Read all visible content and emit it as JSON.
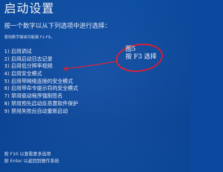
{
  "screen": {
    "title": "启动设置",
    "instruction": "按一个数字以从下列选项中进行选择：",
    "note": "使用数字键或功能键 F1-F9。"
  },
  "options": [
    {
      "num": "1)",
      "label": "启用调试"
    },
    {
      "num": "2)",
      "label": "启用启动日志记录"
    },
    {
      "num": "3)",
      "label": "启用低分辨率视频"
    },
    {
      "num": "4)",
      "label": "启用安全模式"
    },
    {
      "num": "5)",
      "label": "启用带网络连接的安全模式"
    },
    {
      "num": "6)",
      "label": "启用带命令提示符的安全模式"
    },
    {
      "num": "7)",
      "label": "禁用驱动程序强制签名"
    },
    {
      "num": "8)",
      "label": "禁用预先启动反恶意软件保护"
    },
    {
      "num": "9)",
      "label": "禁用失败后自动重新启动"
    }
  ],
  "annotation": {
    "line1": "图5",
    "line2": "按 F3 选择",
    "color": "#e3172a"
  },
  "footer": {
    "line1": "按 F10 以查看更多选项",
    "line2": "按 Enter 以返回到操作系统"
  },
  "colors": {
    "background": "#0b4aa2",
    "text": "#ffffff",
    "annotation": "#e3172a"
  }
}
